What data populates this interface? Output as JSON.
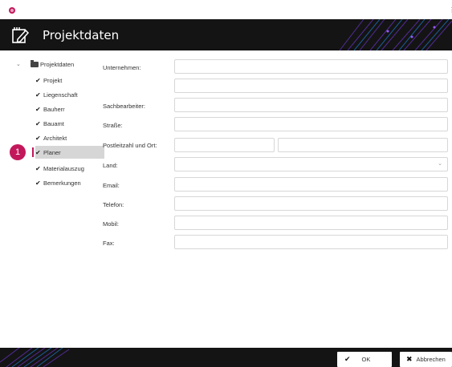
{
  "window": {
    "more_icon": "⋮"
  },
  "header": {
    "title": "Projektdaten"
  },
  "tree": {
    "expand_icon": "⌄",
    "root": "Projektdaten",
    "check_icon": "✔",
    "items": [
      "Projekt",
      "Liegenschaft",
      "Bauherr",
      "Bauamt",
      "Architekt",
      "Planer",
      "Materialauszug",
      "Bemerkungen"
    ],
    "selected": "Planer"
  },
  "annotation": {
    "badge": "1"
  },
  "form": {
    "labels": {
      "company": "Unternehmen:",
      "clerk": "Sachbearbeiter:",
      "street": "Straße:",
      "zip_city": "Postleitzahl und Ort:",
      "country": "Land:",
      "email": "Email:",
      "phone": "Telefon:",
      "mobile": "Mobil:",
      "fax": "Fax:"
    },
    "country_arrow": "⌄"
  },
  "footer": {
    "ok_label": "OK",
    "ok_icon": "✔",
    "cancel_label": "Abbrechen",
    "cancel_icon": "✖"
  },
  "colors": {
    "accent": "#c2185b",
    "header_bg": "#141414",
    "selected_bg": "#d6d6d6",
    "field_border": "#d7d7d7"
  }
}
